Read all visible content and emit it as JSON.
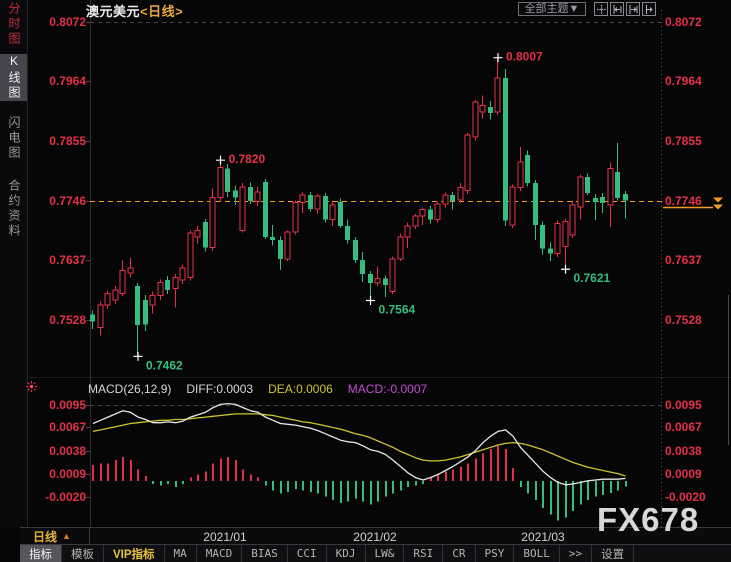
{
  "window": {
    "symbol": "澳元美元",
    "period": "<日线>"
  },
  "top_toolbar": {
    "theme_button": {
      "label": "全部主题",
      "arrow": "▼"
    },
    "icon_buttons": [
      "move-icon",
      "compress-x-icon",
      "expand-x-icon",
      "pan-right-icon"
    ]
  },
  "sidebar": {
    "items": [
      {
        "label": "分时图",
        "color": "#c2303c",
        "active": false
      },
      {
        "label": "K线图",
        "color": "#f2f2f2",
        "active": true
      },
      {
        "label": "闪电图",
        "color": "#9a9a9a",
        "active": false
      },
      {
        "label": "合约资料",
        "color": "#9a9a9a",
        "active": false
      }
    ]
  },
  "indicator_icon": "alarm-asterisk-icon",
  "date_axis": {
    "period_label": "日线",
    "period_arrow": "▲"
  },
  "watermark": "FX678",
  "bottom_toolbar": {
    "items": [
      {
        "label": "指标",
        "selected": true
      },
      {
        "label": "模板"
      },
      {
        "label": "VIP指标",
        "accent": true
      },
      {
        "label": "MA",
        "mono": true
      },
      {
        "label": "MACD",
        "mono": true
      },
      {
        "label": "BIAS",
        "mono": true
      },
      {
        "label": "CCI",
        "mono": true
      },
      {
        "label": "KDJ",
        "mono": true
      },
      {
        "label": "LW&",
        "mono": true
      },
      {
        "label": "RSI",
        "mono": true
      },
      {
        "label": "CR",
        "mono": true
      },
      {
        "label": "PSY",
        "mono": true
      },
      {
        "label": "BOLL",
        "mono": true
      },
      {
        "label": ">>",
        "mono": true
      },
      {
        "label": "设置"
      }
    ]
  },
  "chart_data": [
    {
      "type": "candlestick",
      "title": "澳元美元<日线>",
      "ylim": [
        0.7428,
        0.8094
      ],
      "y_axis_ticks": [
        {
          "label": "0.8072",
          "value": 0.8072
        },
        {
          "label": "0.7964",
          "value": 0.7964
        },
        {
          "label": "0.7855",
          "value": 0.7855
        },
        {
          "label": "0.7746",
          "value": 0.7746
        },
        {
          "label": "0.7637",
          "value": 0.7637
        },
        {
          "label": "0.7528",
          "value": 0.7528
        }
      ],
      "x_ticks": [
        {
          "label": "2021/01",
          "index": 17.6
        },
        {
          "label": "2021/02",
          "index": 37.6
        },
        {
          "label": "2021/03",
          "index": 60
        }
      ],
      "current_price": {
        "label": "0.7746",
        "value": 0.7746
      },
      "annotations": [
        {
          "text": "0.7820",
          "value": 0.782,
          "index": 17,
          "kind": "high"
        },
        {
          "text": "0.8007",
          "value": 0.8007,
          "index": 54,
          "kind": "high"
        },
        {
          "text": "0.7462",
          "value": 0.7462,
          "index": 6,
          "kind": "low"
        },
        {
          "text": "0.7564",
          "value": 0.7564,
          "index": 37,
          "kind": "low"
        },
        {
          "text": "0.7621",
          "value": 0.7621,
          "index": 63,
          "kind": "low"
        }
      ],
      "colors": {
        "up": "#e5304a",
        "down": "#35bd7f",
        "axis_text": "#e5304a",
        "current_line": "#f59a23"
      },
      "ohlc": [
        [
          0.7538,
          0.7546,
          0.7512,
          0.7526
        ],
        [
          0.7515,
          0.7562,
          0.75,
          0.7556
        ],
        [
          0.7556,
          0.7582,
          0.7548,
          0.7577
        ],
        [
          0.7565,
          0.759,
          0.7558,
          0.7583
        ],
        [
          0.7577,
          0.7637,
          0.7572,
          0.7619
        ],
        [
          0.7614,
          0.7642,
          0.7606,
          0.7623
        ],
        [
          0.759,
          0.7596,
          0.7462,
          0.7519
        ],
        [
          0.7565,
          0.7574,
          0.7508,
          0.752
        ],
        [
          0.7556,
          0.758,
          0.754,
          0.7573
        ],
        [
          0.7573,
          0.7602,
          0.7565,
          0.7597
        ],
        [
          0.7601,
          0.7609,
          0.7576,
          0.7583
        ],
        [
          0.7586,
          0.7612,
          0.7551,
          0.7606
        ],
        [
          0.7601,
          0.763,
          0.7594,
          0.7623
        ],
        [
          0.7606,
          0.7692,
          0.76,
          0.7687
        ],
        [
          0.768,
          0.77,
          0.7668,
          0.7692
        ],
        [
          0.7707,
          0.7713,
          0.7653,
          0.7661
        ],
        [
          0.7661,
          0.7768,
          0.7654,
          0.7752
        ],
        [
          0.7752,
          0.782,
          0.7744,
          0.7807
        ],
        [
          0.7805,
          0.7813,
          0.7753,
          0.7762
        ],
        [
          0.7765,
          0.7774,
          0.7738,
          0.7752
        ],
        [
          0.7692,
          0.7778,
          0.7688,
          0.7771
        ],
        [
          0.7771,
          0.7779,
          0.774,
          0.7745
        ],
        [
          0.7745,
          0.7772,
          0.7736,
          0.7762
        ],
        [
          0.778,
          0.7786,
          0.7676,
          0.768
        ],
        [
          0.768,
          0.7702,
          0.7664,
          0.7674
        ],
        [
          0.7674,
          0.7681,
          0.762,
          0.764
        ],
        [
          0.764,
          0.7692,
          0.7636,
          0.7689
        ],
        [
          0.7689,
          0.7746,
          0.7684,
          0.7743
        ],
        [
          0.7743,
          0.7761,
          0.7724,
          0.7756
        ],
        [
          0.7756,
          0.7762,
          0.7726,
          0.7731
        ],
        [
          0.7731,
          0.7758,
          0.7722,
          0.7755
        ],
        [
          0.7755,
          0.776,
          0.7706,
          0.7712
        ],
        [
          0.7712,
          0.7746,
          0.77,
          0.7738
        ],
        [
          0.7744,
          0.775,
          0.7696,
          0.77
        ],
        [
          0.77,
          0.7712,
          0.7668,
          0.7674
        ],
        [
          0.7674,
          0.768,
          0.7632,
          0.7638
        ],
        [
          0.7638,
          0.7652,
          0.7598,
          0.7612
        ],
        [
          0.7612,
          0.7618,
          0.7564,
          0.7596
        ],
        [
          0.7596,
          0.7626,
          0.759,
          0.7604
        ],
        [
          0.7604,
          0.761,
          0.757,
          0.7592
        ],
        [
          0.758,
          0.7644,
          0.7576,
          0.764
        ],
        [
          0.764,
          0.7686,
          0.7636,
          0.768
        ],
        [
          0.768,
          0.7706,
          0.766,
          0.77
        ],
        [
          0.77,
          0.7722,
          0.7694,
          0.7718
        ],
        [
          0.7718,
          0.7734,
          0.7702,
          0.773
        ],
        [
          0.773,
          0.7736,
          0.7704,
          0.7712
        ],
        [
          0.7712,
          0.7744,
          0.7706,
          0.774
        ],
        [
          0.774,
          0.7761,
          0.7734,
          0.7756
        ],
        [
          0.7756,
          0.7762,
          0.773,
          0.7745
        ],
        [
          0.7747,
          0.7778,
          0.7742,
          0.777
        ],
        [
          0.7765,
          0.787,
          0.7758,
          0.7866
        ],
        [
          0.7862,
          0.793,
          0.7856,
          0.7926
        ],
        [
          0.7908,
          0.7938,
          0.7896,
          0.792
        ],
        [
          0.7917,
          0.7928,
          0.7894,
          0.7906
        ],
        [
          0.7908,
          0.8007,
          0.7902,
          0.797
        ],
        [
          0.797,
          0.7986,
          0.77,
          0.771
        ],
        [
          0.7702,
          0.7776,
          0.7696,
          0.7771
        ],
        [
          0.777,
          0.7844,
          0.7764,
          0.7817
        ],
        [
          0.7829,
          0.7838,
          0.7772,
          0.7778
        ],
        [
          0.7778,
          0.7784,
          0.7674,
          0.7702
        ],
        [
          0.7702,
          0.7708,
          0.7648,
          0.7659
        ],
        [
          0.7659,
          0.767,
          0.7636,
          0.765
        ],
        [
          0.765,
          0.771,
          0.7643,
          0.7704
        ],
        [
          0.7662,
          0.7714,
          0.7621,
          0.7708
        ],
        [
          0.7683,
          0.7746,
          0.7678,
          0.7738
        ],
        [
          0.7735,
          0.7794,
          0.7712,
          0.7789
        ],
        [
          0.7789,
          0.7796,
          0.7756,
          0.776
        ],
        [
          0.7751,
          0.7758,
          0.7711,
          0.7744
        ],
        [
          0.7753,
          0.776,
          0.7724,
          0.7742
        ],
        [
          0.7738,
          0.7816,
          0.7698,
          0.7805
        ],
        [
          0.7798,
          0.7851,
          0.7746,
          0.7751
        ],
        [
          0.7758,
          0.7764,
          0.7714,
          0.7746
        ]
      ]
    },
    {
      "type": "macd",
      "header": {
        "title": "MACD(26,12,9)",
        "diff": "DIFF:0.0003",
        "dea": "DEA:0.0006",
        "macd": "MACD:-0.0007"
      },
      "ylim": [
        -0.0058,
        0.0104
      ],
      "y_axis_ticks": [
        {
          "label": "0.0095",
          "value": 0.0095
        },
        {
          "label": "0.0067",
          "value": 0.0067
        },
        {
          "label": "0.0038",
          "value": 0.0038
        },
        {
          "label": "0.0009",
          "value": 0.0009
        },
        {
          "label": "-0.0020",
          "value": -0.002
        }
      ],
      "colors": {
        "diff": "#e8e8e8",
        "dea": "#cdc52f",
        "macd_text": "#c44fd0",
        "hist_up": "#e5304a",
        "hist_down": "#35bd7f"
      },
      "diff": [
        0.0072,
        0.0076,
        0.008,
        0.0084,
        0.0088,
        0.0086,
        0.008,
        0.0077,
        0.0073,
        0.0073,
        0.0074,
        0.0073,
        0.0075,
        0.008,
        0.0083,
        0.0086,
        0.0092,
        0.0096,
        0.0097,
        0.0096,
        0.0092,
        0.0088,
        0.0086,
        0.008,
        0.0076,
        0.0072,
        0.0071,
        0.007,
        0.0068,
        0.0066,
        0.0063,
        0.0059,
        0.0055,
        0.0051,
        0.0049,
        0.0048,
        0.0044,
        0.0039,
        0.0037,
        0.0033,
        0.0026,
        0.0018,
        0.001,
        0.0004,
        0.0001,
        0.0004,
        0.0008,
        0.0013,
        0.0018,
        0.0024,
        0.003,
        0.0038,
        0.0048,
        0.0056,
        0.0062,
        0.0064,
        0.0056,
        0.0042,
        0.0032,
        0.0022,
        0.0012,
        0.0004,
        -0.0002,
        -0.0005,
        -0.0004,
        -0.0002,
        0.0,
        0.0001,
        0.0002,
        0.0002,
        0.0002,
        0.0003
      ],
      "dea": [
        0.0062,
        0.0064,
        0.0066,
        0.0068,
        0.007,
        0.0072,
        0.0073,
        0.0074,
        0.0075,
        0.0076,
        0.0076,
        0.0077,
        0.0077,
        0.0078,
        0.0079,
        0.008,
        0.0081,
        0.0082,
        0.0083,
        0.0084,
        0.0084,
        0.0084,
        0.0084,
        0.0083,
        0.0082,
        0.008,
        0.0078,
        0.0076,
        0.0074,
        0.0073,
        0.0071,
        0.0069,
        0.0067,
        0.0065,
        0.0062,
        0.0059,
        0.0057,
        0.0054,
        0.005,
        0.0046,
        0.0042,
        0.0037,
        0.0033,
        0.0029,
        0.0026,
        0.0025,
        0.0025,
        0.0026,
        0.0028,
        0.003,
        0.0033,
        0.0036,
        0.0039,
        0.0042,
        0.0045,
        0.0047,
        0.0048,
        0.0047,
        0.0045,
        0.0042,
        0.0039,
        0.0035,
        0.0031,
        0.0027,
        0.0023,
        0.002,
        0.0017,
        0.0015,
        0.0013,
        0.0011,
        0.0009,
        0.0006
      ],
      "hist": [
        0.002,
        0.0022,
        0.0022,
        0.0026,
        0.003,
        0.0026,
        0.0014,
        0.0006,
        -0.0004,
        -0.0006,
        -0.0004,
        -0.0008,
        -0.0004,
        0.0004,
        0.0008,
        0.0012,
        0.0022,
        0.0028,
        0.003,
        0.0026,
        0.0014,
        0.0008,
        0.0004,
        -0.0006,
        -0.0012,
        -0.0016,
        -0.0014,
        -0.001,
        -0.0012,
        -0.0014,
        -0.0016,
        -0.002,
        -0.0024,
        -0.0028,
        -0.0026,
        -0.0022,
        -0.0026,
        -0.003,
        -0.0026,
        -0.002,
        -0.0016,
        -0.0012,
        -0.0008,
        -0.0006,
        -0.0004,
        0.0004,
        0.0008,
        0.0012,
        0.0014,
        0.0018,
        0.0022,
        0.0028,
        0.0034,
        0.004,
        0.0044,
        0.004,
        0.0016,
        -0.0008,
        -0.0016,
        -0.0024,
        -0.0034,
        -0.0042,
        -0.005,
        -0.0046,
        -0.0038,
        -0.003,
        -0.0024,
        -0.002,
        -0.0018,
        -0.0015,
        -0.0012,
        -0.0007
      ]
    }
  ]
}
